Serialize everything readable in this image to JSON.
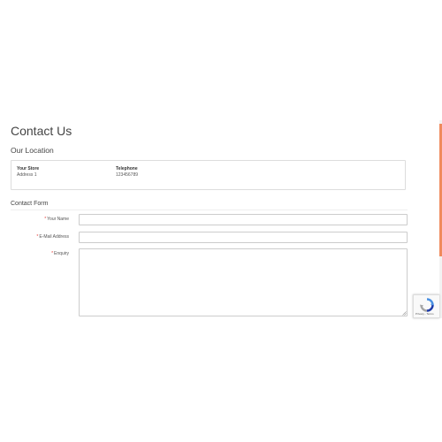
{
  "page": {
    "title": "Contact Us"
  },
  "location": {
    "heading": "Our Location",
    "store_label": "Your Store",
    "store_address": "Address 1",
    "telephone_label": "Telephone",
    "telephone_value": "123456789"
  },
  "form": {
    "heading": "Contact Form",
    "required_mark": "*",
    "name_label": "Your Name",
    "email_label": "E-Mail Address",
    "enquiry_label": "Enquiry",
    "name_value": "",
    "email_value": "",
    "enquiry_value": ""
  },
  "recaptcha": {
    "links": "Privacy - Terms"
  },
  "colors": {
    "accent_scrollbar": "#f08a5d",
    "required": "#e53935",
    "border": "#cccccc"
  },
  "icons": {
    "recaptcha": "recaptcha-icon",
    "resize": "resize-handle-icon"
  }
}
